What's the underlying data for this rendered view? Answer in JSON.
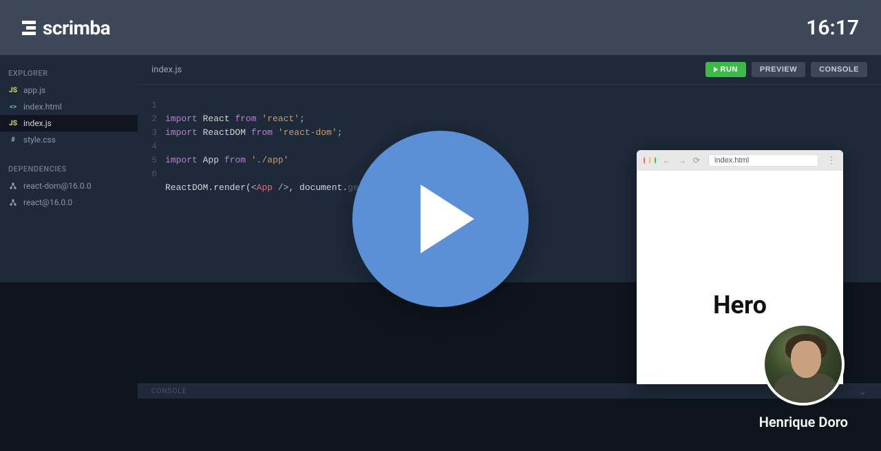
{
  "header": {
    "brand": "scrimba",
    "time": "16:17"
  },
  "sidebar": {
    "explorerTitle": "EXPLORER",
    "files": [
      {
        "name": "app.js",
        "iconType": "js",
        "active": false
      },
      {
        "name": "index.html",
        "iconType": "html",
        "active": false
      },
      {
        "name": "index.js",
        "iconType": "js",
        "active": true
      },
      {
        "name": "style.css",
        "iconType": "css",
        "active": false
      }
    ],
    "dependenciesTitle": "DEPENDENCIES",
    "dependencies": [
      {
        "name": "react-dom@16.0.0"
      },
      {
        "name": "react@16.0.0"
      }
    ]
  },
  "editor": {
    "filename": "index.js",
    "buttons": {
      "run": "RUN",
      "preview": "PREVIEW",
      "console": "CONSOLE"
    },
    "lines": [
      "1",
      "2",
      "3",
      "4",
      "5",
      "6"
    ],
    "code": {
      "l1": {
        "kw": "import",
        "id": "React",
        "from": "from",
        "str": "'react'",
        "p": ";"
      },
      "l2": {
        "kw": "import",
        "id": "ReactDOM",
        "from": "from",
        "str": "'react-dom'",
        "p": ";"
      },
      "l4": {
        "kw": "import",
        "id": "App",
        "from": "from",
        "str": "'./app'"
      },
      "l6": {
        "a": "ReactDOM.render(",
        "tagOpen": "<",
        "tag": "App",
        "tagClose": " />",
        "b": ", document.",
        "dim": "getElementById('root'));"
      }
    }
  },
  "console": {
    "label": "CONSOLE"
  },
  "preview": {
    "url": "index.html",
    "heroText": "Hero"
  },
  "instructor": {
    "name": "Henrique Doro"
  }
}
